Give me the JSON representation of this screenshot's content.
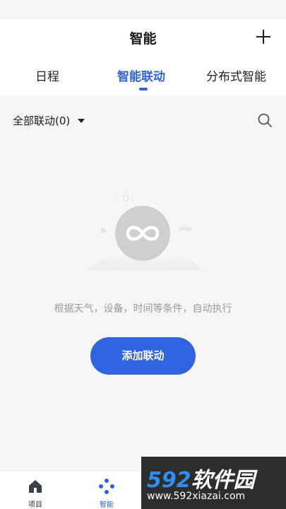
{
  "header": {
    "title": "智能"
  },
  "tabs": [
    {
      "label": "日程"
    },
    {
      "label": "智能联动"
    },
    {
      "label": "分布式智能"
    }
  ],
  "filter": {
    "label": "全部联动(0)"
  },
  "empty_state": {
    "hint": "根据天气，设备，时间等条件，自动执行",
    "action_label": "添加联动"
  },
  "bottom_nav": [
    {
      "label": "项目"
    },
    {
      "label": "智能"
    }
  ],
  "watermark": {
    "logo_num": "592",
    "logo_text": "软件园",
    "url": "www.592xiazai.com"
  },
  "colors": {
    "accent": "#2f63d8",
    "button": "#2f63e0",
    "hint": "#9a9a9a",
    "background": "#f6f6f6"
  }
}
